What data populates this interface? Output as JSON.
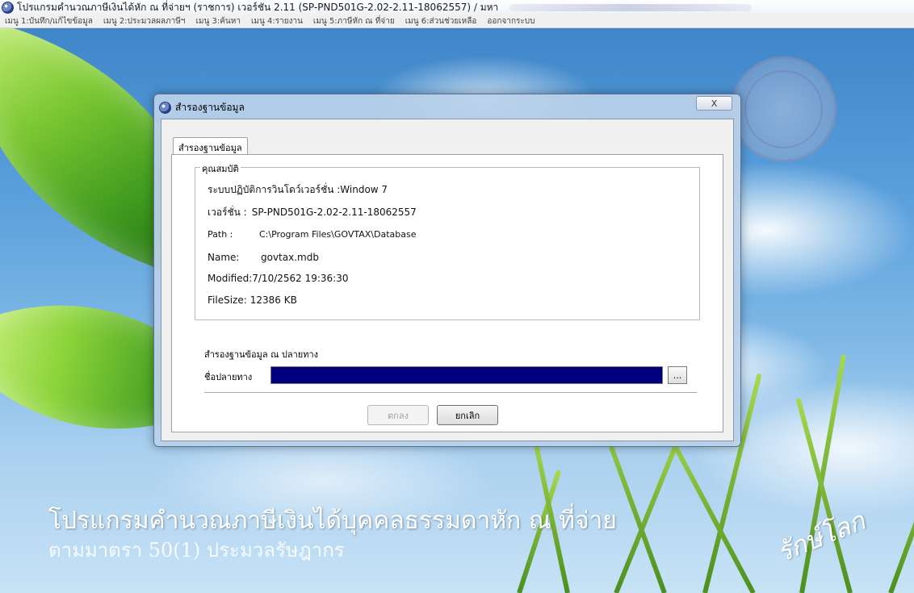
{
  "app": {
    "title": "โปรแกรมคำนวณภาษีเงินได้หัก ณ ที่จ่ายฯ (ราชการ) เวอร์ชัน 2.11 (SP-PND501G-2.02-2.11-18062557) / มหา"
  },
  "menubar": {
    "items": [
      "เมนู 1:บันทึก/แก้ไขข้อมูล",
      "เมนู 2:ประมวลผลภาษีฯ",
      "เมนู 3:ค้นหา",
      "เมนู 4:รายงาน",
      "เมนู 5:ภาษีหัก ณ ที่จ่าย",
      "เมนู 6:ส่วนช่วยเหลือ",
      "ออกจากระบบ"
    ]
  },
  "background": {
    "headline": "โปรแกรมคำนวณภาษีเงินได้บุคคลธรรมดาหัก ณ ที่จ่าย",
    "subline": "ตามมาตรา 50(1) ประมวลรัษฎากร",
    "slogan": "รักษ์โลก"
  },
  "dialog": {
    "title": "สำรองฐานข้อมูล",
    "close_label": "X",
    "tab_label": "สำรองฐานข้อมูล",
    "group_title": "คุณสมบัติ",
    "properties": {
      "os_label": "ระบบปฏิบัติการวินโดว์เวอร์ชั่น : ",
      "os_value": "Window 7",
      "version_label": "เวอร์ชั่น : ",
      "version_value": "SP-PND501G-2.02-2.11-18062557",
      "path_label": "Path : ",
      "path_value": "C:\\Program Files\\GOVTAX\\Database",
      "name_label": "Name: ",
      "name_value": "govtax.mdb",
      "modified_label": "Modified: ",
      "modified_value": "7/10/2562 19:36:30",
      "filesize_label": "FileSize: ",
      "filesize_value": "12386 KB"
    },
    "destination_section": "สำรองฐานข้อมูล ณ ปลายทาง",
    "destination_label": "ชื่อปลายทาง",
    "destination_value": "",
    "browse_label": "...",
    "ok_label": "ตกลง",
    "cancel_label": "ยกเลิก"
  }
}
